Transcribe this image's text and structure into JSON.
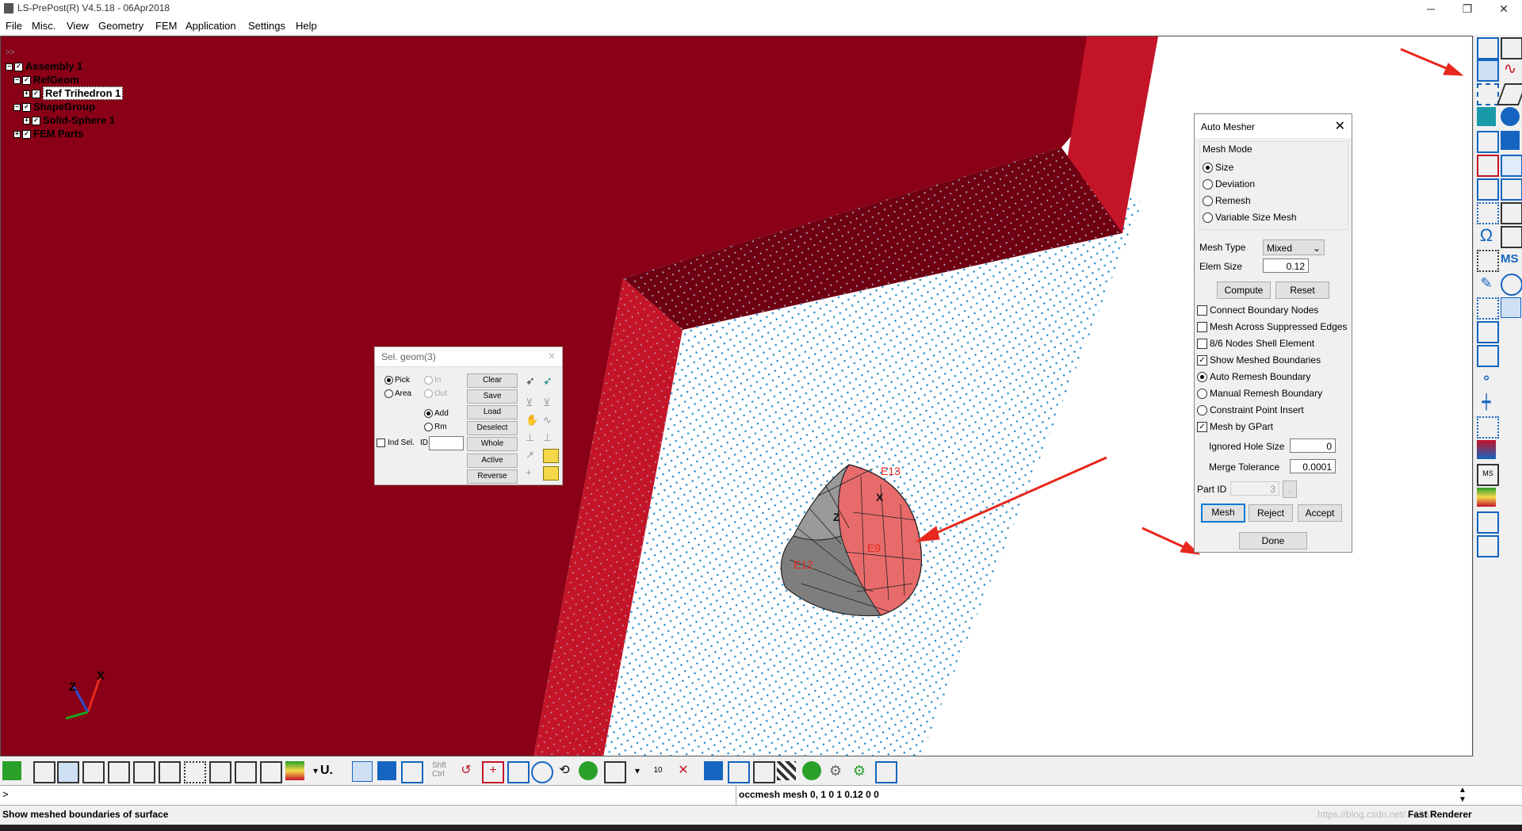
{
  "window": {
    "title": "LS-PrePost(R) V4.5.18 - 06Apr2018",
    "minimize": "─",
    "restore": "❐",
    "close": "✕"
  },
  "menu": [
    "File",
    "Misc.",
    "View",
    "Geometry",
    "FEM",
    "Application",
    "Settings",
    "Help"
  ],
  "tree": {
    "header": ">>",
    "items": [
      {
        "label": "Assembly 1"
      },
      {
        "label": "RefGeom"
      },
      {
        "label": "Ref Trihedron 1"
      },
      {
        "label": "ShapeGroup"
      },
      {
        "label": "Solid-Sphere 1"
      },
      {
        "label": "FEM Parts"
      }
    ]
  },
  "labels": {
    "e13": "E13",
    "e9": "E9",
    "e12": "E12",
    "x_local": "X",
    "z_local": "Z"
  },
  "axes": {
    "x": "X",
    "z": "Z"
  },
  "sel_geom": {
    "title": "Sel. geom(3)",
    "pick": "Pick",
    "area": "Area",
    "in": "In",
    "out": "Out",
    "add": "Add",
    "rm": "Rm",
    "ind_sel": "Ind Sel.",
    "id_label": "ID",
    "buttons": [
      "Clear",
      "Save",
      "Load",
      "Deselect",
      "Whole",
      "Active",
      "Reverse"
    ]
  },
  "auto_mesher": {
    "title": "Auto Mesher",
    "close": "✕",
    "mesh_mode_label": "Mesh Mode",
    "modes": [
      "Size",
      "Deviation",
      "Remesh",
      "Variable Size Mesh"
    ],
    "mesh_type_label": "Mesh Type",
    "mesh_type_value": "Mixed",
    "elem_size_label": "Elem Size",
    "elem_size_value": "0.12",
    "compute": "Compute",
    "reset": "Reset",
    "options": [
      {
        "label": "Connect Boundary Nodes",
        "kind": "checkbox",
        "checked": false
      },
      {
        "label": "Mesh Across Suppressed Edges",
        "kind": "checkbox",
        "checked": false
      },
      {
        "label": "8/6 Nodes Shell Element",
        "kind": "checkbox",
        "checked": false
      },
      {
        "label": "Show Meshed Boundaries",
        "kind": "checkbox",
        "checked": true
      },
      {
        "label": "Auto Remesh Boundary",
        "kind": "radio",
        "checked": true
      },
      {
        "label": "Manual Remesh Boundary",
        "kind": "radio",
        "checked": false
      },
      {
        "label": "Constraint Point Insert",
        "kind": "radio",
        "checked": false
      },
      {
        "label": "Mesh by GPart",
        "kind": "checkbox",
        "checked": true
      }
    ],
    "ignored_hole_label": "Ignored Hole Size",
    "ignored_hole_value": "0",
    "merge_tol_label": "Merge Tolerance",
    "merge_tol_value": "0.0001",
    "part_id_label": "Part ID",
    "part_id_value": "3",
    "part_id_btn": ".",
    "mesh": "Mesh",
    "reject": "Reject",
    "accept": "Accept",
    "done": "Done"
  },
  "toolbar": {
    "shft_ctrl_1": "Shft",
    "shft_ctrl_2": "Ctrl",
    "u_label": "U.",
    "num_10": "10"
  },
  "command": {
    "prompt": ">",
    "history": "occmesh mesh 0, 1 0 1 0.12 0 0"
  },
  "status": {
    "message": "Show meshed boundaries of surface",
    "renderer": "Fast Renderer",
    "watermark": "https://blog.csdn.net/...4353"
  },
  "colors": {
    "wall": "#8a0016",
    "wall_edge": "#c41428",
    "dots": "#2a8fd0",
    "arrow": "#e8281e",
    "accent": "#0078d7"
  }
}
